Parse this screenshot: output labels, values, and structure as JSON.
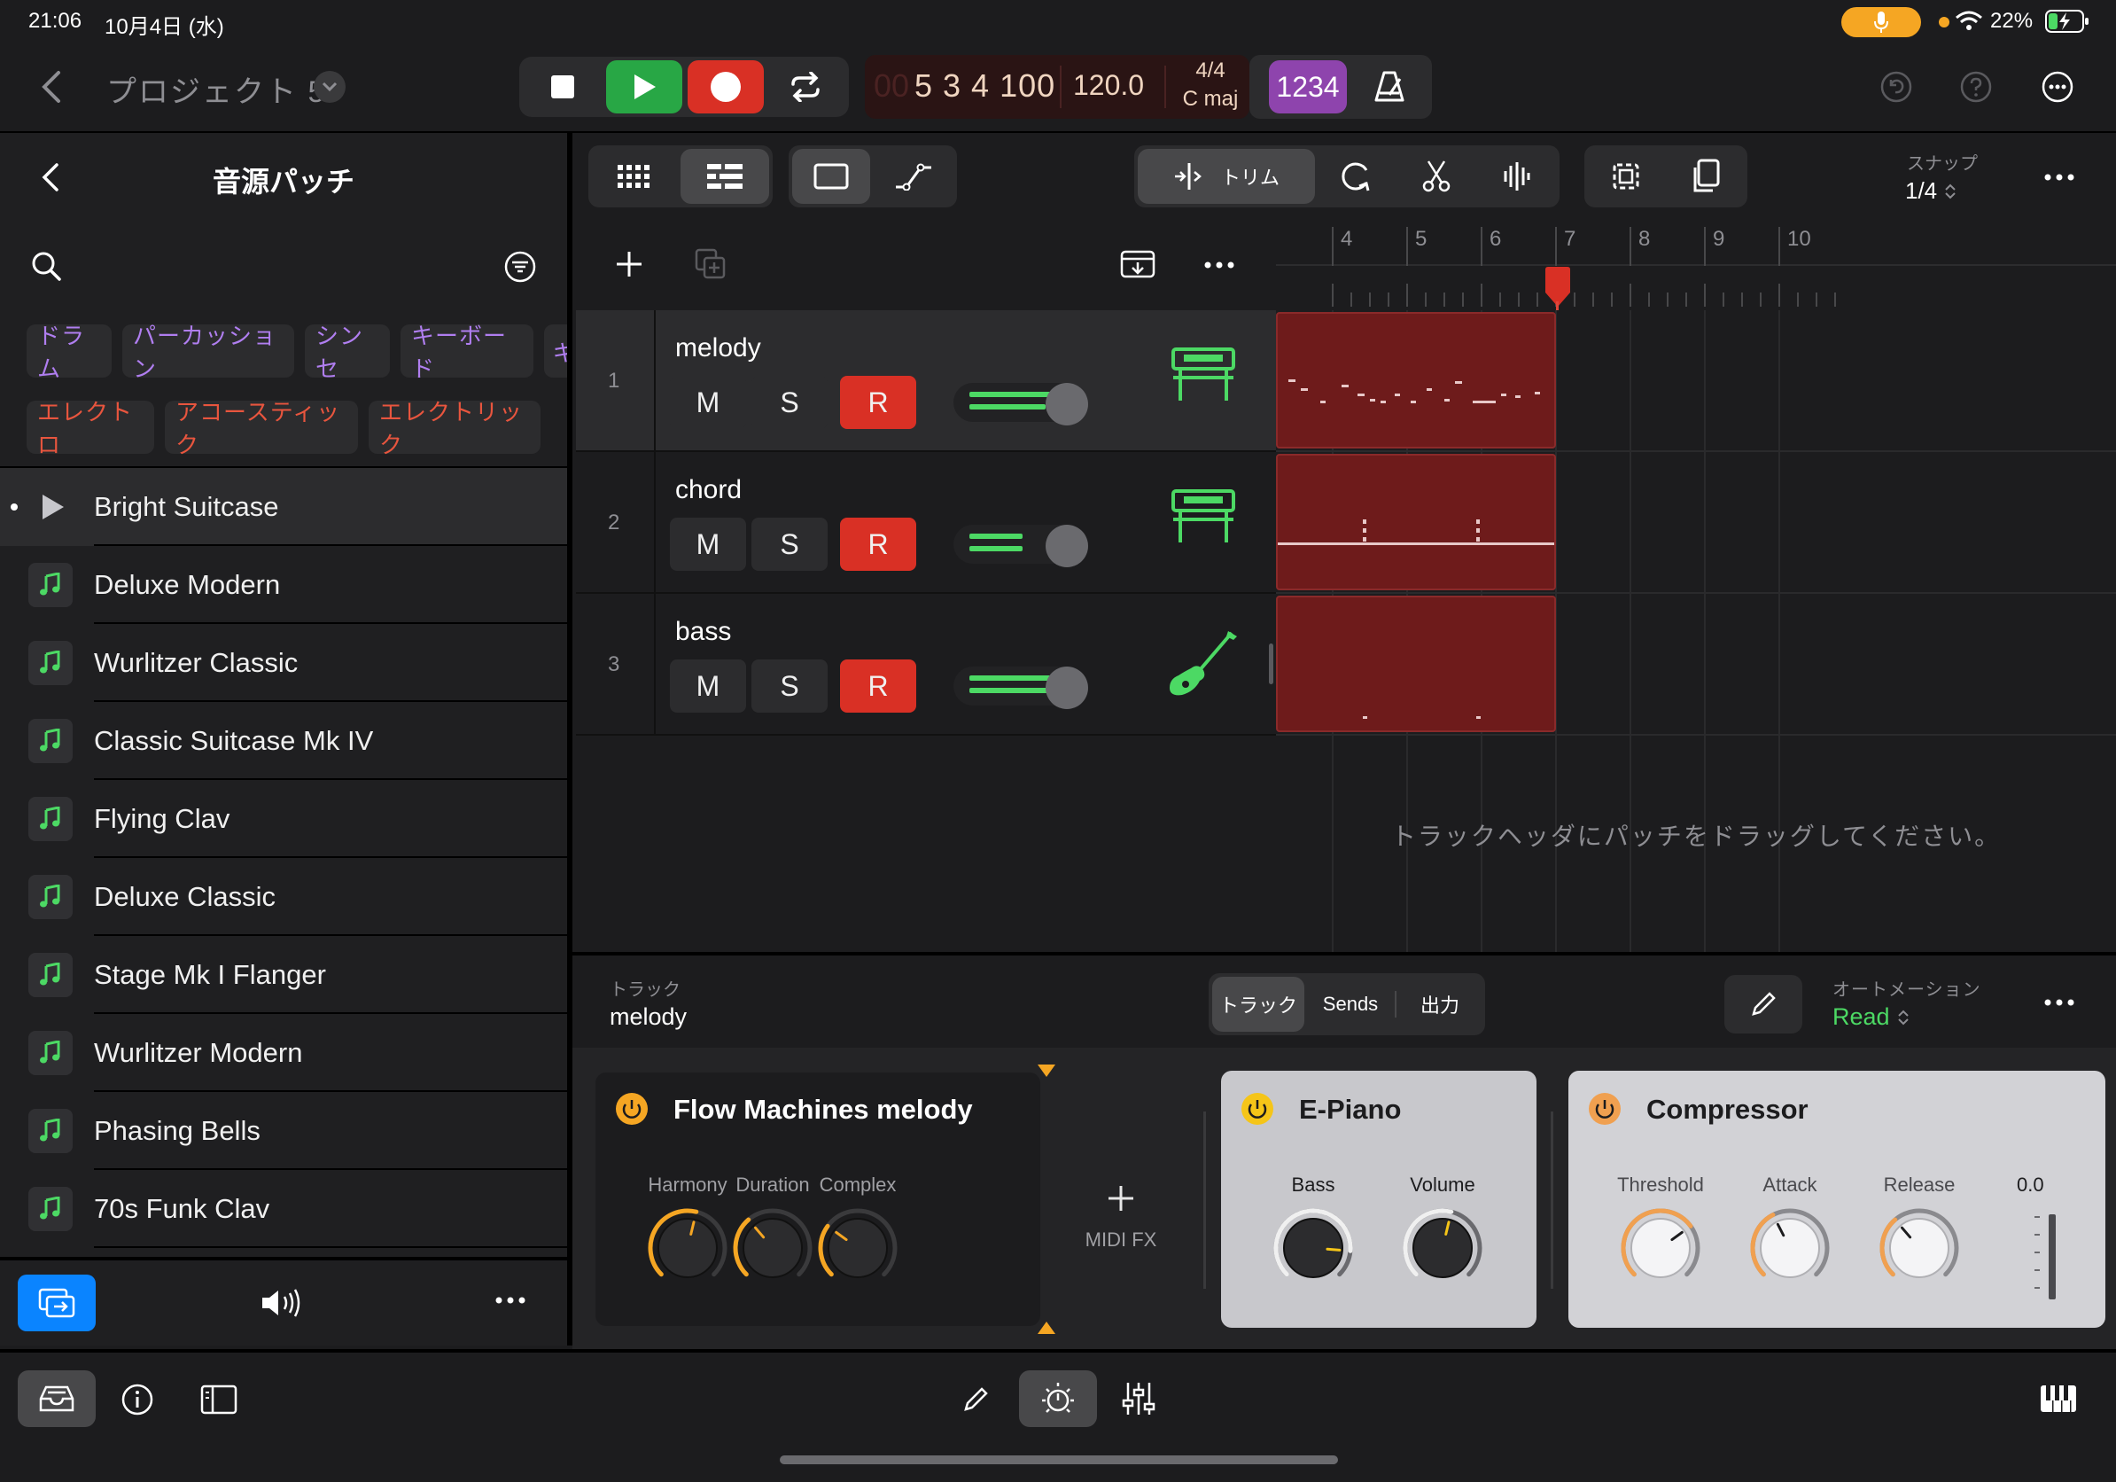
{
  "status_bar": {
    "time": "21:06",
    "date": "10月4日 (水)",
    "battery": "22%",
    "icons": [
      "mic-icon",
      "wifi-icon",
      "battery-charging-icon"
    ]
  },
  "header": {
    "project_title": "プロジェクト 5",
    "lcd": {
      "position": "5 3 4 100",
      "position_dim": "00",
      "tempo": "120.0",
      "signature": "4/4",
      "key": "C maj"
    },
    "count_in_label": "1234"
  },
  "left_panel": {
    "title": "音源パッチ",
    "category_chips_row1": [
      "ドラム",
      "パーカッション",
      "シンセ",
      "キーボード",
      "ギ"
    ],
    "category_chips_row2": [
      "エレクトロ",
      "アコースティック",
      "エレクトリック"
    ],
    "patches": [
      {
        "name": "Bright Suitcase",
        "playing": true
      },
      {
        "name": "Deluxe Modern"
      },
      {
        "name": "Wurlitzer Classic"
      },
      {
        "name": "Classic Suitcase Mk IV"
      },
      {
        "name": "Flying Clav"
      },
      {
        "name": "Deluxe Classic"
      },
      {
        "name": "Stage Mk I Flanger"
      },
      {
        "name": "Wurlitzer Modern"
      },
      {
        "name": "Phasing Bells"
      },
      {
        "name": "70s Funk Clav"
      }
    ]
  },
  "edit_toolbar": {
    "trim_label": "トリム",
    "snap_label": "スナップ",
    "snap_value": "1/4"
  },
  "ruler": {
    "bars": [
      "4",
      "5",
      "6",
      "7",
      "8",
      "9",
      "10"
    ]
  },
  "tracks": [
    {
      "number": "1",
      "name": "melody",
      "mute": "M",
      "solo": "S",
      "record": "R",
      "volume": 0.9,
      "instrument_icon": "keyboard-stand-icon"
    },
    {
      "number": "2",
      "name": "chord",
      "mute": "M",
      "solo": "S",
      "record": "R",
      "volume": 0.55,
      "instrument_icon": "keyboard-stand-icon"
    },
    {
      "number": "3",
      "name": "bass",
      "mute": "M",
      "solo": "S",
      "record": "R",
      "volume": 0.85,
      "instrument_icon": "bass-guitar-icon"
    }
  ],
  "drop_hint": "トラックヘッダにパッチをドラッグしてください。",
  "inspector": {
    "section_label": "トラック",
    "track_name": "melody",
    "tabs": [
      "トラック",
      "Sends",
      "出力"
    ],
    "automation_label": "オートメーション",
    "automation_value": "Read"
  },
  "plugins": {
    "midi_fx": {
      "title": "Flow Machines melody",
      "knobs": [
        {
          "label": "Harmony",
          "value": 0.55
        },
        {
          "label": "Duration",
          "value": 0.35
        },
        {
          "label": "Complex",
          "value": 0.3
        }
      ]
    },
    "add_midi_fx_label": "MIDI FX",
    "instrument": {
      "title": "E-Piano",
      "knobs": [
        {
          "label": "Bass",
          "value": 0.85
        },
        {
          "label": "Volume",
          "value": 0.55
        }
      ]
    },
    "compressor": {
      "title": "Compressor",
      "knobs": [
        {
          "label": "Threshold",
          "value": 0.7
        },
        {
          "label": "Attack",
          "value": 0.4
        },
        {
          "label": "Release",
          "value": 0.35
        }
      ],
      "meter_value": "0.0"
    }
  },
  "colors": {
    "accent_green": "#4cd964",
    "record_red": "#d93025",
    "region_red": "#6e1b1b",
    "amber": "#f5a623",
    "purple": "#8e44ad",
    "blue": "#0a84ff"
  }
}
